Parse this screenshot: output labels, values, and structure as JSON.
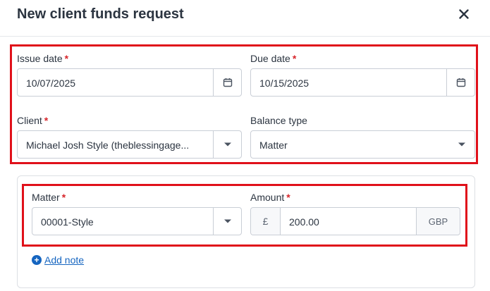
{
  "dialog": {
    "title": "New client funds request",
    "close_label": "×"
  },
  "form": {
    "required_mark": "*",
    "issue_date": {
      "label": "Issue date",
      "value": "10/07/2025",
      "icon": "calendar-icon"
    },
    "due_date": {
      "label": "Due date",
      "value": "10/15/2025",
      "icon": "calendar-icon"
    },
    "client": {
      "label": "Client",
      "value": "Michael Josh Style (theblessingage..."
    },
    "balance_type": {
      "label": "Balance type",
      "value": "Matter"
    },
    "matter": {
      "label": "Matter",
      "value": "00001-Style"
    },
    "amount": {
      "label": "Amount",
      "currency_symbol": "£",
      "value": "200.00",
      "currency": "GBP"
    },
    "add_note": {
      "label": "Add note",
      "icon": "plus-circle-icon"
    }
  },
  "colors": {
    "highlight": "#e0101a",
    "link": "#1565c0",
    "required": "#d7262b"
  }
}
